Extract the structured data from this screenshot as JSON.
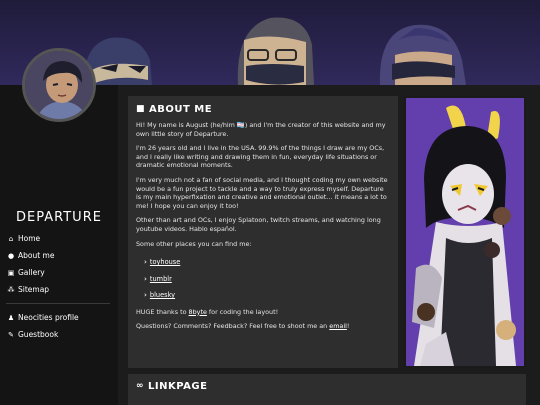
{
  "sidebar": {
    "site_title": "DEPARTURE",
    "nav": [
      {
        "label": "Home",
        "icon": "home-icon"
      },
      {
        "label": "About me",
        "icon": "info-icon"
      },
      {
        "label": "Gallery",
        "icon": "gallery-icon"
      },
      {
        "label": "Sitemap",
        "icon": "sitemap-icon"
      }
    ],
    "nav2": [
      {
        "label": "Neocities profile",
        "icon": "user-icon"
      },
      {
        "label": "Guestbook",
        "icon": "feather-icon"
      }
    ]
  },
  "about": {
    "heading": "ABOUT ME",
    "p1": "Hi! My name is August (he/him 🏳️‍⚧️) and I'm the creator of this website and my own little story of Departure.",
    "p2": "I'm 26 years old and I live in the USA. 99.9% of the things I draw are my OCs, and I really like writing and drawing them in fun, everyday life situations or dramatic emotional moments.",
    "p3": "I'm very much not a fan of social media, and I thought coding my own website would be a fun project to tackle and a way to truly express myself. Departure is my main hyperfixation and creative and emotional outlet... it means a lot to me! I hope you can enjoy it too!",
    "p4": "Other than art and OCs, I enjoy Splatoon, twitch streams, and watching long youtube videos. Hablo español.",
    "p5": "Some other places you can find me:",
    "links": [
      "toyhouse",
      "tumblr",
      "bluesky"
    ],
    "thanks_pre": "HUGE thanks to ",
    "thanks_link": "8byte",
    "thanks_post": " for coding the layout!",
    "contact_pre": "Questions? Comments? Feedback? Feel free to shoot me an ",
    "contact_link": "email",
    "contact_post": "!"
  },
  "linkpage": {
    "heading": "LINKPAGE"
  },
  "colors": {
    "banner": "#2b2552",
    "sidebar": "#141414",
    "panel": "#2e2e2e",
    "art_bg": "#5b3aa6"
  }
}
